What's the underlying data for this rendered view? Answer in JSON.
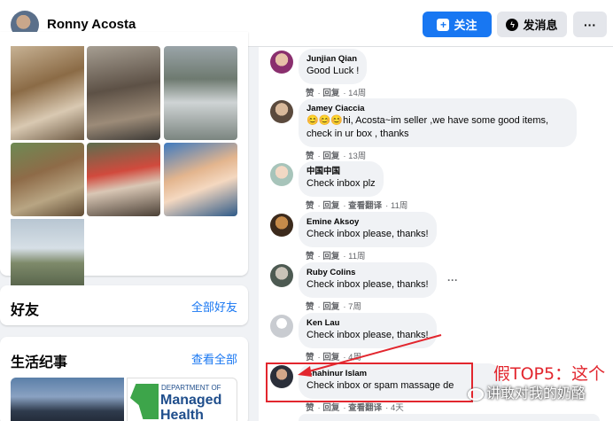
{
  "header": {
    "profile_name": "Ronny Acosta",
    "follow_label": "关注",
    "message_label": "发消息",
    "more_label": "···",
    "accent_color": "#1877f2"
  },
  "left": {
    "friends": {
      "title": "好友",
      "link": "全部好友"
    },
    "life_events": {
      "title": "生活纪事",
      "link": "查看全部",
      "card2_line1": "DEPARTMENT OF",
      "card2_line2": "Managed",
      "card2_line3": "Health"
    }
  },
  "comments": [
    {
      "name": "Junjian Qian",
      "text": "Good Luck !",
      "like": "赞",
      "reply": "回复",
      "time": "14周"
    },
    {
      "name": "Jamey Ciaccia",
      "text_line1": "😊😊😊hi, Acosta~im seller ,we have some good items,",
      "text_line2": "check in ur box , thanks",
      "like": "赞",
      "reply": "回复",
      "time": "13周"
    },
    {
      "name": "中国中国",
      "text": "Check inbox plz",
      "like": "赞",
      "reply": "回复",
      "translate": "查看翻译",
      "time": "11周"
    },
    {
      "name": "Emine Aksoy",
      "text": "Check inbox please, thanks!",
      "like": "赞",
      "reply": "回复",
      "time": "11周"
    },
    {
      "name": "Ruby Colins",
      "text": "Check inbox please, thanks!",
      "like": "赞",
      "reply": "回复",
      "time": "7周",
      "more": "···"
    },
    {
      "name": "Ken Lau",
      "text": "Check inbox please, thanks!",
      "like": "赞",
      "reply": "回复",
      "time": "4周"
    },
    {
      "name": "Shahinur Islam",
      "text": "Check inbox or spam massage de",
      "like": "赞",
      "reply": "回复",
      "translate": "查看翻译",
      "time": "4天"
    }
  ],
  "annotation": {
    "label": "假TOP5：这个",
    "watermark": "讲敢对我的奶酪",
    "color": "#e2262e"
  }
}
